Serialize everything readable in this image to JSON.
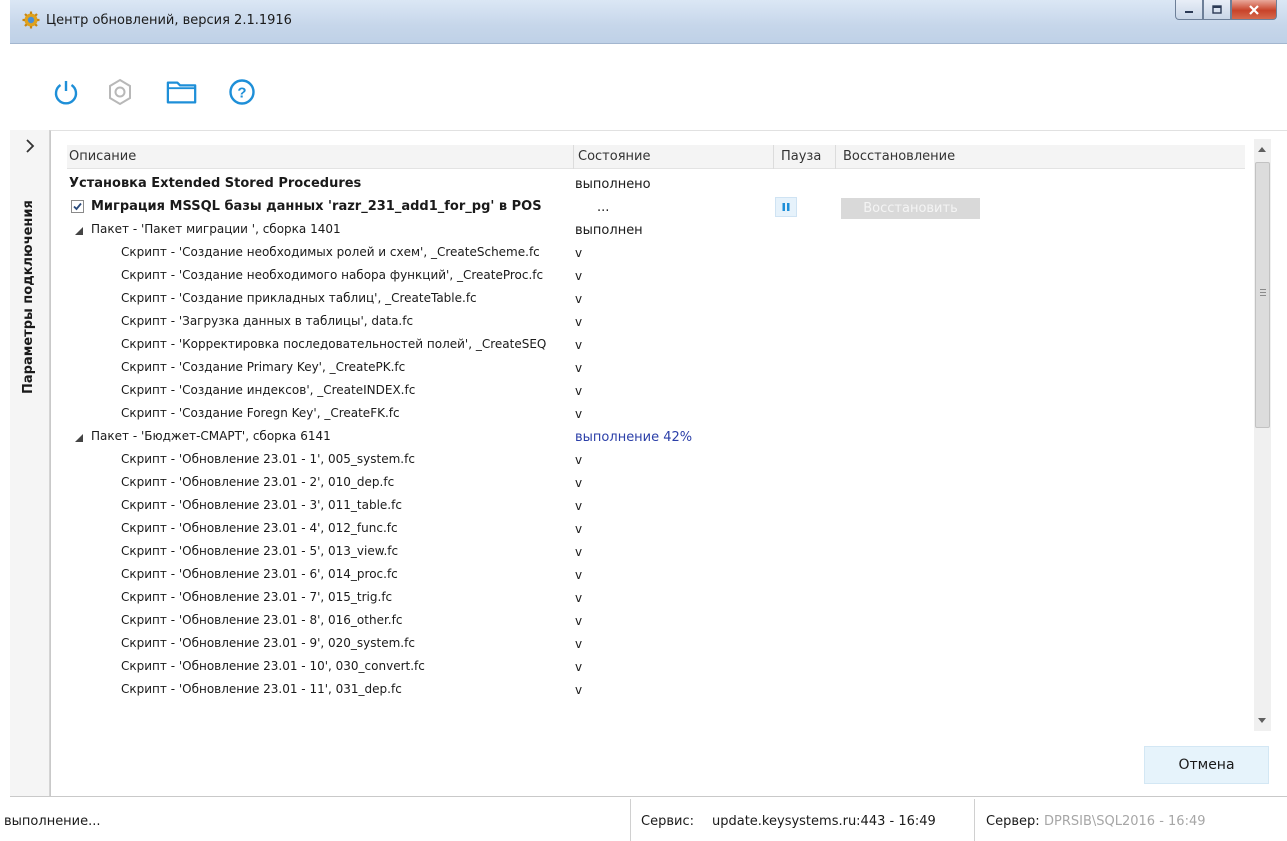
{
  "window": {
    "title": "Центр обновлений, версия 2.1.1916"
  },
  "toolbar": {
    "icons": [
      "power-icon",
      "gear-icon",
      "folder-icon",
      "help-icon"
    ],
    "accent": "#1e8fd8",
    "disabled": "#b8b8b8"
  },
  "side_panel": {
    "label": "Параметры подключения"
  },
  "grid": {
    "columns": {
      "description": "Описание",
      "state": "Состояние",
      "pause": "Пауза",
      "restore": "Восстановление"
    },
    "rows": [
      {
        "type": "task",
        "desc": "Установка Extended Stored Procedures",
        "state": "выполнено"
      },
      {
        "type": "task-check",
        "desc": "Миграция MSSQL базы данных 'razr_231_add1_for_pg' в POS",
        "state": "...",
        "restore_label": "Восстановить"
      },
      {
        "type": "package",
        "desc": "Пакет - 'Пакет миграции ', сборка 1401",
        "state": "выполнен"
      },
      {
        "type": "script",
        "desc": "Скрипт - 'Создание необходимых ролей и схем', _CreateScheme.fc",
        "state": "v"
      },
      {
        "type": "script",
        "desc": "Скрипт - 'Создание необходимого набора функций', _CreateProc.fc",
        "state": "v"
      },
      {
        "type": "script",
        "desc": "Скрипт - 'Создание прикладных таблиц', _CreateTable.fc",
        "state": "v"
      },
      {
        "type": "script",
        "desc": "Скрипт - 'Загрузка данных в таблицы', data.fc",
        "state": "v"
      },
      {
        "type": "script",
        "desc": "Скрипт - 'Корректировка последовательностей полей', _CreateSEQ",
        "state": "v"
      },
      {
        "type": "script",
        "desc": "Скрипт - 'Создание Primary Key', _CreatePK.fc",
        "state": "v"
      },
      {
        "type": "script",
        "desc": "Скрипт - 'Создание индексов', _CreateINDEX.fc",
        "state": "v"
      },
      {
        "type": "script",
        "desc": "Скрипт - 'Создание Foregn Key', _CreateFK.fc",
        "state": "v"
      },
      {
        "type": "package",
        "desc": "Пакет - 'Бюджет-СМАРТ', сборка 6141",
        "state": "выполнение 42%",
        "progress": true
      },
      {
        "type": "script",
        "desc": "Скрипт - 'Обновление 23.01 - 1', 005_system.fc",
        "state": "v"
      },
      {
        "type": "script",
        "desc": "Скрипт - 'Обновление 23.01 - 2', 010_dep.fc",
        "state": "v"
      },
      {
        "type": "script",
        "desc": "Скрипт - 'Обновление 23.01 - 3', 011_table.fc",
        "state": "v"
      },
      {
        "type": "script",
        "desc": "Скрипт - 'Обновление 23.01 - 4', 012_func.fc",
        "state": "v"
      },
      {
        "type": "script",
        "desc": "Скрипт - 'Обновление 23.01 - 5', 013_view.fc",
        "state": "v"
      },
      {
        "type": "script",
        "desc": "Скрипт - 'Обновление 23.01 - 6', 014_proc.fc",
        "state": "v"
      },
      {
        "type": "script",
        "desc": "Скрипт - 'Обновление 23.01 - 7', 015_trig.fc",
        "state": "v"
      },
      {
        "type": "script",
        "desc": "Скрипт - 'Обновление 23.01 - 8', 016_other.fc",
        "state": "v"
      },
      {
        "type": "script",
        "desc": "Скрипт - 'Обновление 23.01 - 9', 020_system.fc",
        "state": "v"
      },
      {
        "type": "script",
        "desc": "Скрипт - 'Обновление 23.01 - 10', 030_convert.fc",
        "state": "v"
      },
      {
        "type": "script",
        "desc": "Скрипт - 'Обновление 23.01 - 11', 031_dep.fc",
        "state": "v"
      }
    ]
  },
  "actions": {
    "cancel_label": "Отмена"
  },
  "status": {
    "message": "выполнение...",
    "service_label": "Сервис:",
    "service_value": "update.keysystems.ru:443 - 16:49",
    "server_label": "Сервер:",
    "server_value": "DPRSIB\\SQL2016 - 16:49"
  }
}
